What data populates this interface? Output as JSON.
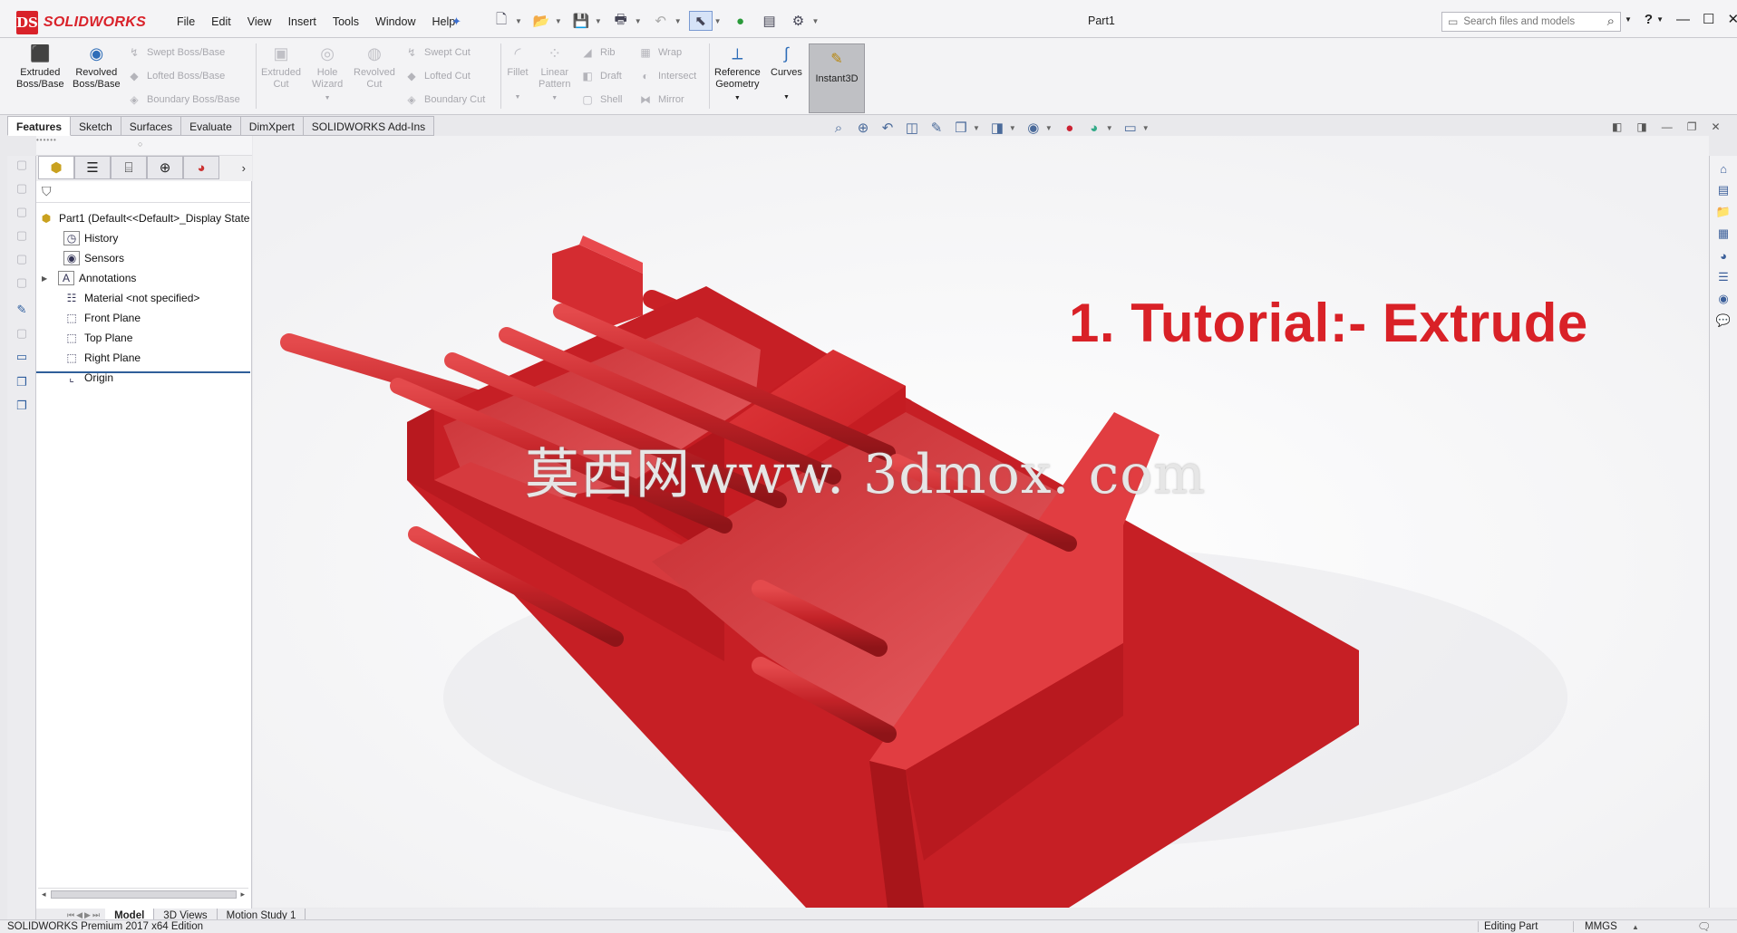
{
  "app": {
    "brand": "SOLIDWORKS",
    "brand_mark": "DS",
    "document_title": "Part1",
    "accent": "#d9222a"
  },
  "menu": [
    "File",
    "Edit",
    "View",
    "Insert",
    "Tools",
    "Window",
    "Help"
  ],
  "search": {
    "placeholder": "Search files and models"
  },
  "help_label": "?",
  "command_manager": {
    "extruded_boss": "Extruded\nBoss/Base",
    "revolved_boss": "Revolved\nBoss/Base",
    "swept_boss": "Swept Boss/Base",
    "lofted_boss": "Lofted Boss/Base",
    "boundary_boss": "Boundary Boss/Base",
    "extruded_cut": "Extruded\nCut",
    "hole_wizard": "Hole\nWizard",
    "revolved_cut": "Revolved\nCut",
    "swept_cut": "Swept Cut",
    "lofted_cut": "Lofted Cut",
    "boundary_cut": "Boundary Cut",
    "fillet": "Fillet",
    "linear_pattern": "Linear\nPattern",
    "rib": "Rib",
    "draft": "Draft",
    "shell": "Shell",
    "wrap": "Wrap",
    "intersect": "Intersect",
    "mirror": "Mirror",
    "reference_geometry": "Reference\nGeometry",
    "curves": "Curves",
    "instant3d": "Instant3D"
  },
  "tabs": [
    "Features",
    "Sketch",
    "Surfaces",
    "Evaluate",
    "DimXpert",
    "SOLIDWORKS Add-Ins"
  ],
  "active_tab": "Features",
  "feature_tree": {
    "root": "Part1  (Default<<Default>_Display State",
    "items": [
      {
        "label": "History",
        "icon": "history-icon"
      },
      {
        "label": "Sensors",
        "icon": "sensors-icon"
      },
      {
        "label": "Annotations",
        "icon": "annotations-icon"
      },
      {
        "label": "Material <not specified>",
        "icon": "material-icon"
      },
      {
        "label": "Front Plane",
        "icon": "plane-icon"
      },
      {
        "label": "Top Plane",
        "icon": "plane-icon"
      },
      {
        "label": "Right Plane",
        "icon": "plane-icon"
      },
      {
        "label": "Origin",
        "icon": "origin-icon"
      }
    ]
  },
  "viewport": {
    "overlay_title": "1. Tutorial:- Extrude",
    "watermark": "莫西网www. 3dmox. com",
    "model_color": "#d32a2e"
  },
  "bottom_tabs": [
    "Model",
    "3D Views",
    "Motion Study 1"
  ],
  "status": {
    "edition": "SOLIDWORKS Premium 2017 x64 Edition",
    "mode": "Editing Part",
    "units": "MMGS"
  }
}
